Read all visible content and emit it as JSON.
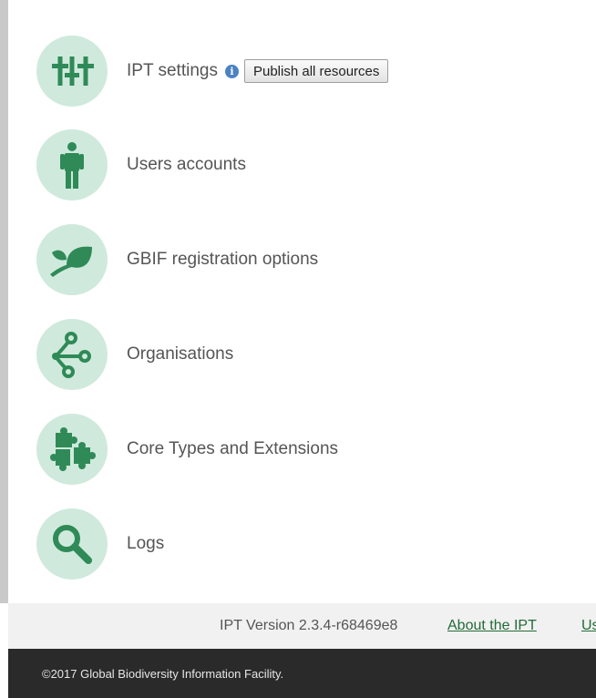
{
  "menu": {
    "items": [
      {
        "label": "IPT settings",
        "icon": "sliders-icon"
      },
      {
        "label": "Users accounts",
        "icon": "user-icon"
      },
      {
        "label": "GBIF registration options",
        "icon": "leaf-icon"
      },
      {
        "label": "Organisations",
        "icon": "network-icon"
      },
      {
        "label": "Core Types and Extensions",
        "icon": "puzzle-icon"
      },
      {
        "label": "Logs",
        "icon": "magnifier-icon"
      }
    ],
    "info_symbol": "i",
    "publish_button": "Publish all resources"
  },
  "footer": {
    "version": "IPT Version 2.3.4-r68469e8",
    "about_link": "About the IPT",
    "cut_link": "Us"
  },
  "bottom_bar": {
    "copyright": "©2017 Global Biodiversity Information Facility."
  },
  "colors": {
    "icon_green": "#2f8a57",
    "circle_bg": "#cfeadc",
    "link_green": "#236b36",
    "info_blue": "#4a82c3",
    "dark_bar": "#2a2a2a"
  }
}
